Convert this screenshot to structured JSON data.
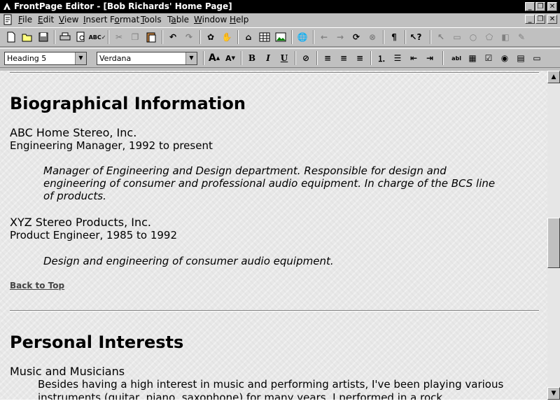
{
  "window": {
    "title": "FrontPage Editor - [Bob Richards' Home Page]",
    "controls": [
      "minimize-icon",
      "restore-icon",
      "close-icon"
    ]
  },
  "menu": {
    "items": [
      {
        "label": "File",
        "accel": "F"
      },
      {
        "label": "Edit",
        "accel": "E"
      },
      {
        "label": "View",
        "accel": "V"
      },
      {
        "label": "Insert",
        "accel": "I"
      },
      {
        "label": "Format",
        "accel": "o"
      },
      {
        "label": "Tools",
        "accel": "T"
      },
      {
        "label": "Table",
        "accel": "a"
      },
      {
        "label": "Window",
        "accel": "W"
      },
      {
        "label": "Help",
        "accel": "H"
      }
    ]
  },
  "toolbar": {
    "style_value": "Heading 5",
    "font_value": "Verdana",
    "bold_label": "B",
    "italic_label": "I",
    "underline_label": "U",
    "paragraph_mark": "¶"
  },
  "document": {
    "section1": {
      "heading": "Biographical Information",
      "jobs": [
        {
          "company": "ABC Home Stereo, Inc.",
          "role": "Engineering Manager, 1992 to present",
          "description": "Manager of Engineering and Design department. Responsible for design and engineering of consumer and professional audio equipment. In charge of the BCS line of products."
        },
        {
          "company": "XYZ Stereo Products, Inc.",
          "role": "Product Engineer, 1985 to 1992",
          "description": "Design and engineering of consumer audio equipment."
        }
      ],
      "back_link": "Back to Top"
    },
    "section2": {
      "heading": "Personal Interests",
      "subheading": "Music and Musicians",
      "paragraph": "Besides having a high interest in music and performing artists, I've been playing various instruments (guitar, piano, saxophone) for many years. I performed in a rock"
    }
  },
  "colors": {
    "title_bar": "#000000",
    "chrome": "#c0c0c0",
    "page_background": "#e8e8e8"
  }
}
